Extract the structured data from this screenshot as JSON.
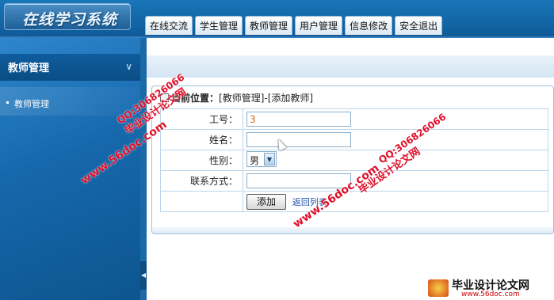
{
  "app": {
    "logo_text": "在线学习系统"
  },
  "nav": {
    "tabs": [
      "在线交流",
      "学生管理",
      "教师管理",
      "用户管理",
      "信息修改",
      "安全退出"
    ]
  },
  "sidebar": {
    "title": "教师管理",
    "items": [
      {
        "label": "教师管理"
      }
    ]
  },
  "breadcrumb": {
    "label": "当前位置：",
    "path": "[教师管理]-[添加教师]"
  },
  "form": {
    "fields": [
      {
        "label": "工号：",
        "value": "3"
      },
      {
        "label": "姓名：",
        "value": ""
      },
      {
        "label": "性别：",
        "value": "男"
      },
      {
        "label": "联系方式：",
        "value": ""
      }
    ],
    "submit_label": "添加",
    "back_label": "返回列表"
  },
  "watermarks": {
    "site": "www.56doc.com",
    "qq": "QQ:306826066",
    "title": "毕业设计论文网"
  },
  "brand": {
    "name": "毕业设计论文网",
    "url": "www.56doc.com"
  },
  "colors": {
    "header": "#1976b8",
    "sidebar": "#1668ac",
    "watermark": "#e0102a",
    "link": "#1d4fb0"
  }
}
